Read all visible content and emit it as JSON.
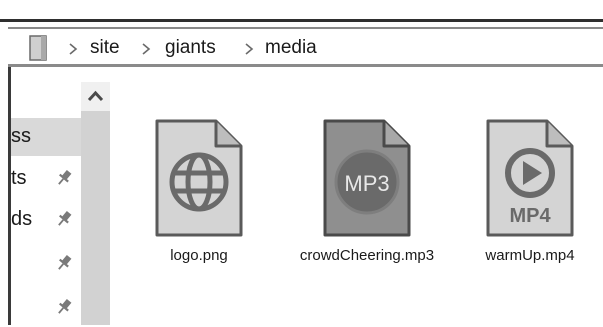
{
  "breadcrumb": {
    "items": [
      "site",
      "giants",
      "media"
    ]
  },
  "sidebar": {
    "items": [
      {
        "label": "ss",
        "pinned": false,
        "selected": true
      },
      {
        "label": "ts",
        "pinned": true,
        "selected": false
      },
      {
        "label": "ds",
        "pinned": true,
        "selected": false
      },
      {
        "label": "",
        "pinned": true,
        "selected": false
      },
      {
        "label": "",
        "pinned": true,
        "selected": false
      }
    ]
  },
  "files": [
    {
      "name": "logo.png",
      "icon": "globe-file-icon"
    },
    {
      "name": "crowdCheering.mp3",
      "icon": "mp3-file-icon",
      "badge": "MP3"
    },
    {
      "name": "warmUp.mp4",
      "icon": "mp4-file-icon",
      "badge": "MP4"
    }
  ],
  "colors": {
    "icon_fill": "#d4d4d4",
    "icon_stroke": "#5a5a5a",
    "mp3_fill": "#8f8f8f",
    "selected_row": "#d9d9d9",
    "scrollbar": "#d2d2d2"
  }
}
